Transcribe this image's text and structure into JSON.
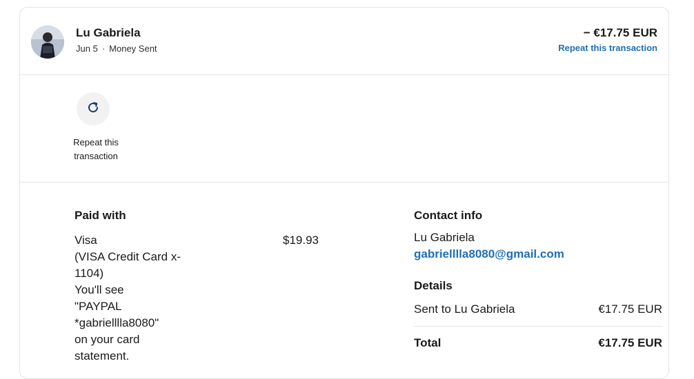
{
  "header": {
    "name": "Lu Gabriela",
    "date": "Jun 5",
    "separator": "·",
    "type": "Money Sent",
    "amount": "− €17.75 EUR",
    "repeat_link": "Repeat this transaction"
  },
  "actions": {
    "repeat_label_line1": "Repeat this",
    "repeat_label_line2": "transaction",
    "icon": "refresh-icon"
  },
  "paid_with": {
    "title": "Paid with",
    "lines": [
      "Visa",
      "(VISA Credit Card x-",
      "1104)",
      "You'll see",
      "\"PAYPAL",
      "*gabrielllla8080\"",
      "on your card",
      "statement."
    ],
    "amount": "$19.93"
  },
  "contact": {
    "title": "Contact info",
    "name": "Lu Gabriela",
    "email": "gabrielllla8080@gmail.com"
  },
  "details": {
    "title": "Details",
    "sent_label": "Sent to Lu Gabriela",
    "sent_value": "€17.75 EUR",
    "total_label": "Total",
    "total_value": "€17.75 EUR"
  },
  "colors": {
    "link": "#1f6fb2",
    "divider": "#e6e6e6",
    "action_circle": "#f2f2f2"
  }
}
